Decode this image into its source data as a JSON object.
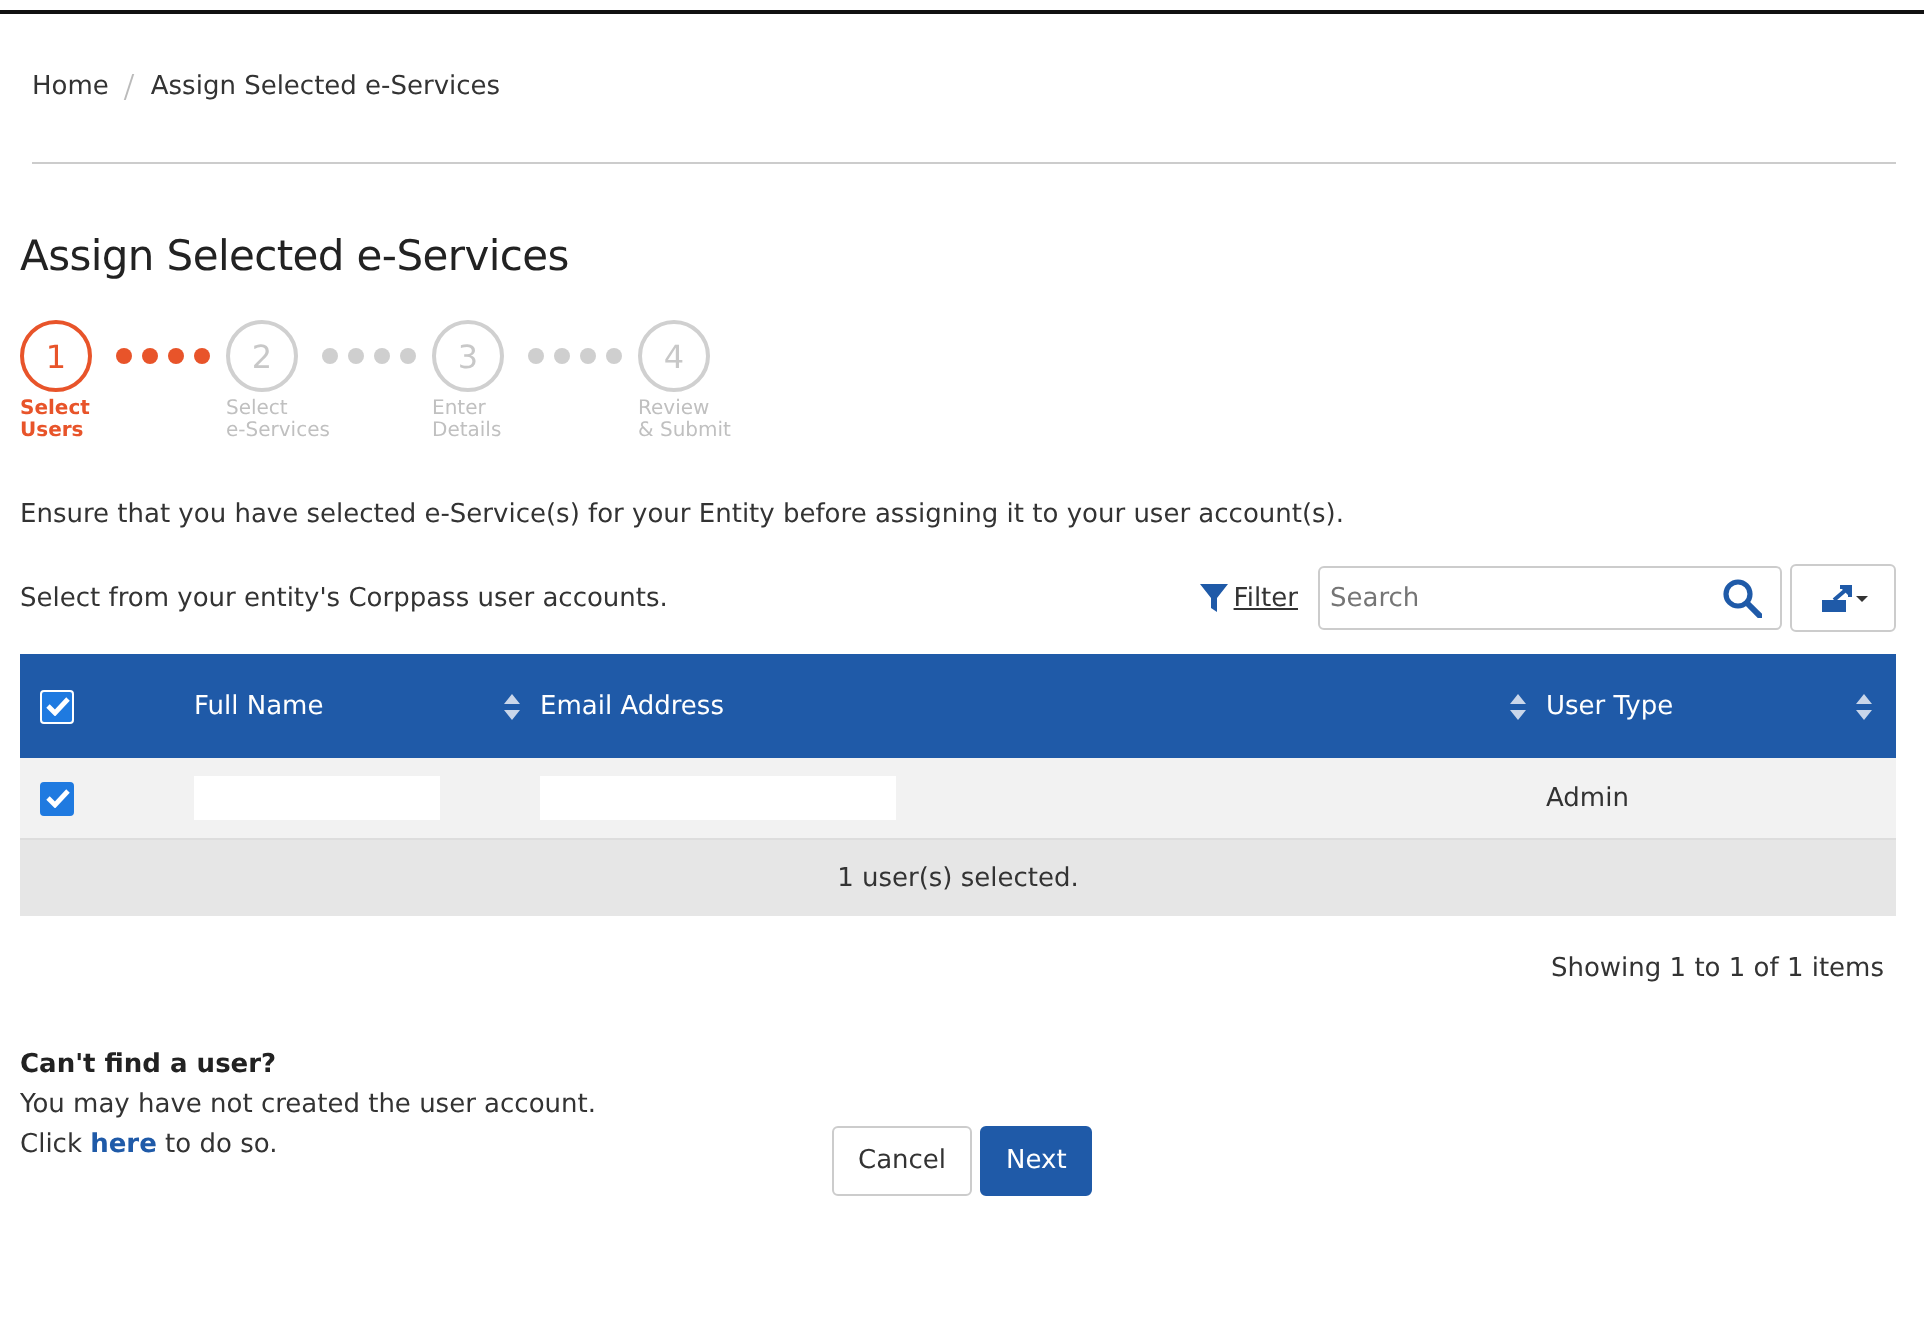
{
  "breadcrumb": [
    {
      "label": "Home"
    },
    {
      "label": "Assign Selected e-Services"
    }
  ],
  "title": "Assign Selected e-Services",
  "steps": [
    {
      "number": "1",
      "label": [
        "Select",
        "Users"
      ],
      "active": true
    },
    {
      "number": "2",
      "label": [
        "Select",
        "e-Services"
      ],
      "active": false
    },
    {
      "number": "3",
      "label": [
        "Enter",
        "Details"
      ],
      "active": false
    },
    {
      "number": "4",
      "label": [
        "Review",
        "& Submit"
      ],
      "active": false
    }
  ],
  "notice": "Ensure that you have selected e-Service(s) for your Entity before assigning it to your user account(s).",
  "instruction": "Select from your entity's Corppass user accounts.",
  "filter": "Filter",
  "search": {
    "placeholder": "Search"
  },
  "table": {
    "select_all": {
      "checked": true
    },
    "columns": [
      {
        "label": "Full Name"
      },
      {
        "label": "Email Address"
      },
      {
        "label": "User Type"
      }
    ],
    "rows": [
      {
        "checked": true,
        "cells": [
          {
            "kind": "redacted"
          },
          {
            "kind": "redacted"
          },
          {
            "kind": "text",
            "text": "Admin"
          }
        ]
      }
    ],
    "summary": "1 user(s) selected."
  },
  "pagination": "Showing 1 to 1 of 1 items",
  "help": {
    "heading": "Can't find a user?",
    "line": "You may have not created the user account.",
    "before": "Click ",
    "link": "here",
    "after": " to do so."
  },
  "buttons": [
    {
      "label": "Cancel",
      "kind": "secondary"
    },
    {
      "label": "Next",
      "kind": "primary"
    }
  ]
}
